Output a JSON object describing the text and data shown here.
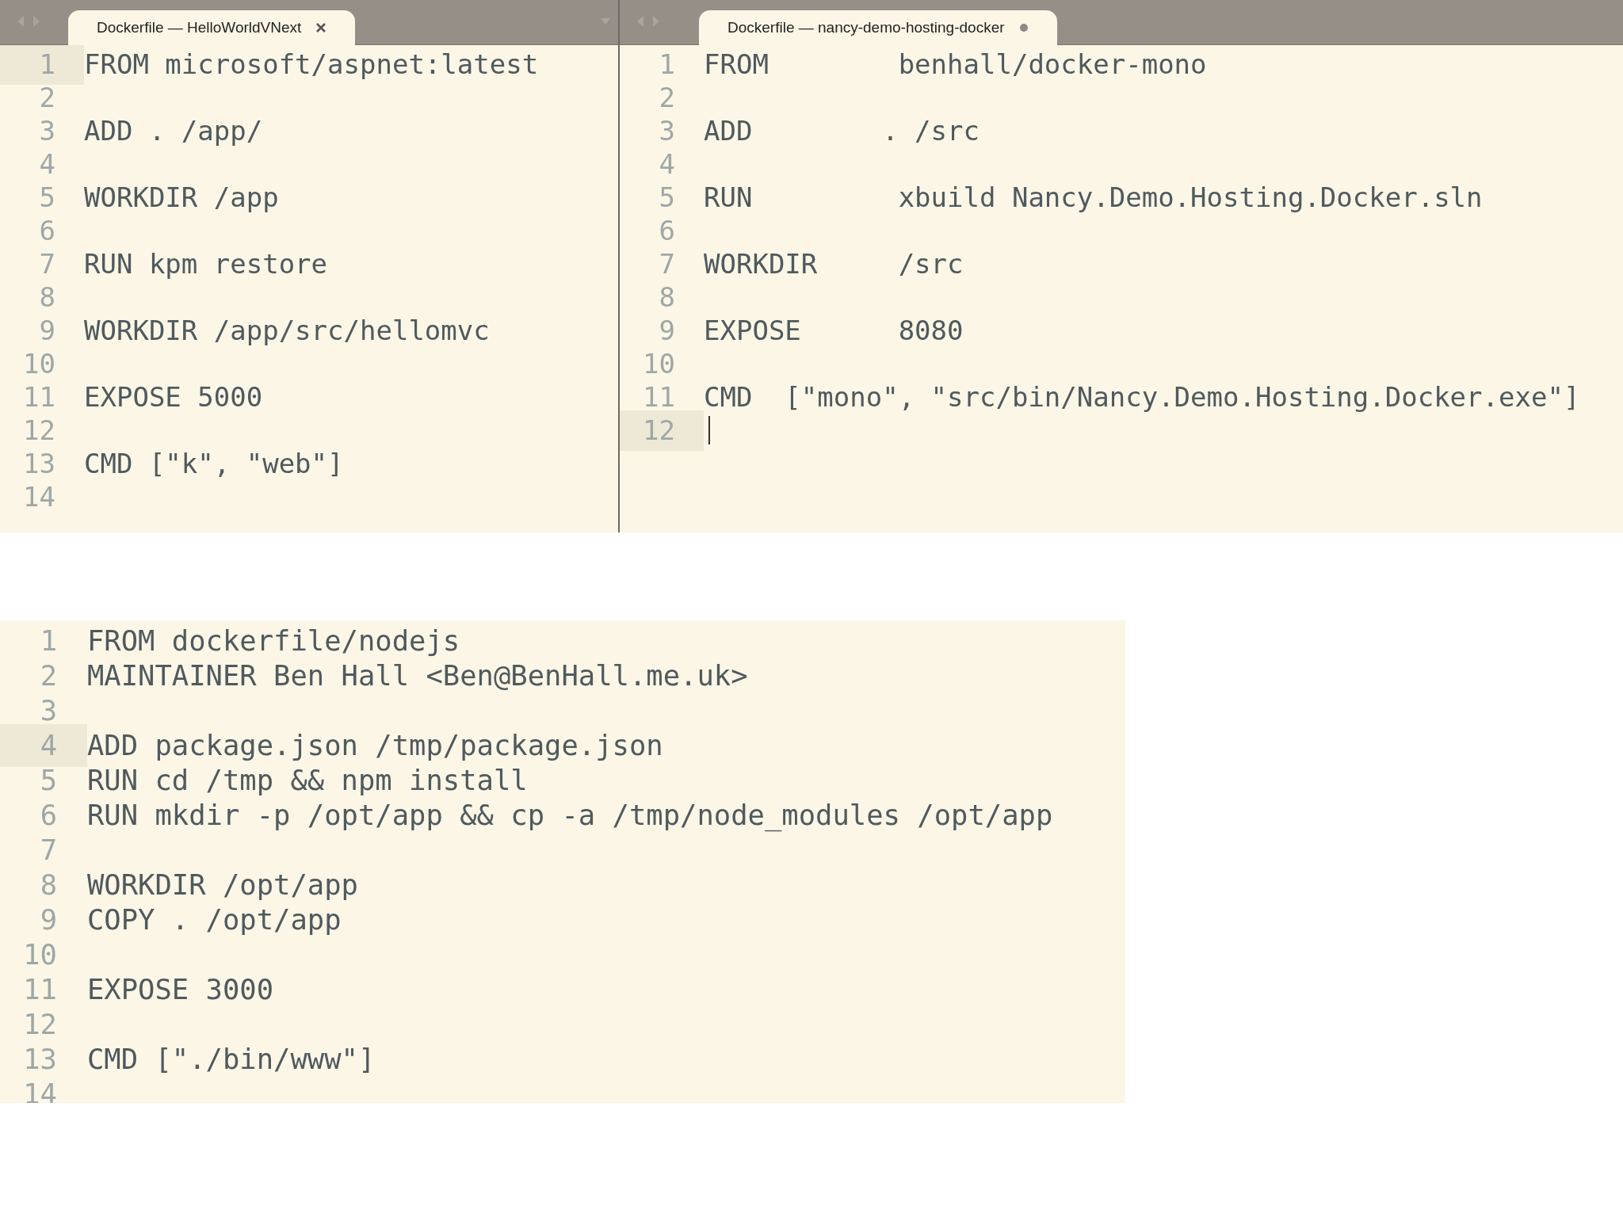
{
  "panes": [
    {
      "tab": {
        "title": "Dockerfile — HelloWorldVNext",
        "modified": false
      },
      "lines": [
        {
          "number": "1",
          "text": "FROM microsoft/aspnet:latest",
          "current": true
        },
        {
          "number": "2",
          "current": false
        },
        {
          "number": "3",
          "text": "ADD . /app/",
          "current": false
        },
        {
          "number": "4",
          "current": false
        },
        {
          "number": "5",
          "text": "WORKDIR /app",
          "current": false
        },
        {
          "number": "6",
          "current": false
        },
        {
          "number": "7",
          "text": "RUN kpm restore",
          "current": false
        },
        {
          "number": "8",
          "current": false
        },
        {
          "number": "9",
          "text": "WORKDIR /app/src/hellomvc",
          "current": false
        },
        {
          "number": "10",
          "current": false
        },
        {
          "number": "11",
          "text": "EXPOSE 5000",
          "current": false
        },
        {
          "number": "12",
          "current": false
        },
        {
          "number": "13",
          "text": "CMD [\"k\", \"web\"]",
          "current": false
        },
        {
          "number": "14",
          "current": false
        }
      ]
    },
    {
      "tab": {
        "title": "Dockerfile — nancy-demo-hosting-docker",
        "modified": true
      },
      "lines": [
        {
          "number": "1",
          "text": "FROM        benhall/docker-mono",
          "current": false
        },
        {
          "number": "2",
          "current": false
        },
        {
          "number": "3",
          "text": "ADD        . /src",
          "current": false
        },
        {
          "number": "4",
          "current": false
        },
        {
          "number": "5",
          "text": "RUN         xbuild Nancy.Demo.Hosting.Docker.sln",
          "current": false
        },
        {
          "number": "6",
          "current": false
        },
        {
          "number": "7",
          "text": "WORKDIR     /src",
          "current": false
        },
        {
          "number": "8",
          "current": false
        },
        {
          "number": "9",
          "text": "EXPOSE      8080",
          "current": false
        },
        {
          "number": "10",
          "current": false
        },
        {
          "number": "11",
          "text": "CMD  [\"mono\", \"src/bin/Nancy.Demo.Hosting.Docker.exe\"]",
          "current": false
        },
        {
          "number": "12",
          "current": true,
          "cursor": true
        }
      ]
    }
  ],
  "bottom_editor": {
    "lines": [
      {
        "number": "1",
        "text": "FROM dockerfile/nodejs",
        "current": false
      },
      {
        "number": "2",
        "text": "MAINTAINER Ben Hall <Ben@BenHall.me.uk>",
        "current": false
      },
      {
        "number": "3",
        "current": false
      },
      {
        "number": "4",
        "text": "ADD package.json /tmp/package.json",
        "current": true
      },
      {
        "number": "5",
        "text": "RUN cd /tmp && npm install",
        "current": false
      },
      {
        "number": "6",
        "text": "RUN mkdir -p /opt/app && cp -a /tmp/node_modules /opt/app",
        "current": false
      },
      {
        "number": "7",
        "current": false
      },
      {
        "number": "8",
        "text": "WORKDIR /opt/app",
        "current": false
      },
      {
        "number": "9",
        "text": "COPY . /opt/app",
        "current": false
      },
      {
        "number": "10",
        "current": false
      },
      {
        "number": "11",
        "text": "EXPOSE 3000",
        "current": false
      },
      {
        "number": "12",
        "current": false
      },
      {
        "number": "13",
        "text": "CMD [\"./bin/www\"]",
        "current": false
      },
      {
        "number": "14",
        "current": false
      }
    ]
  }
}
